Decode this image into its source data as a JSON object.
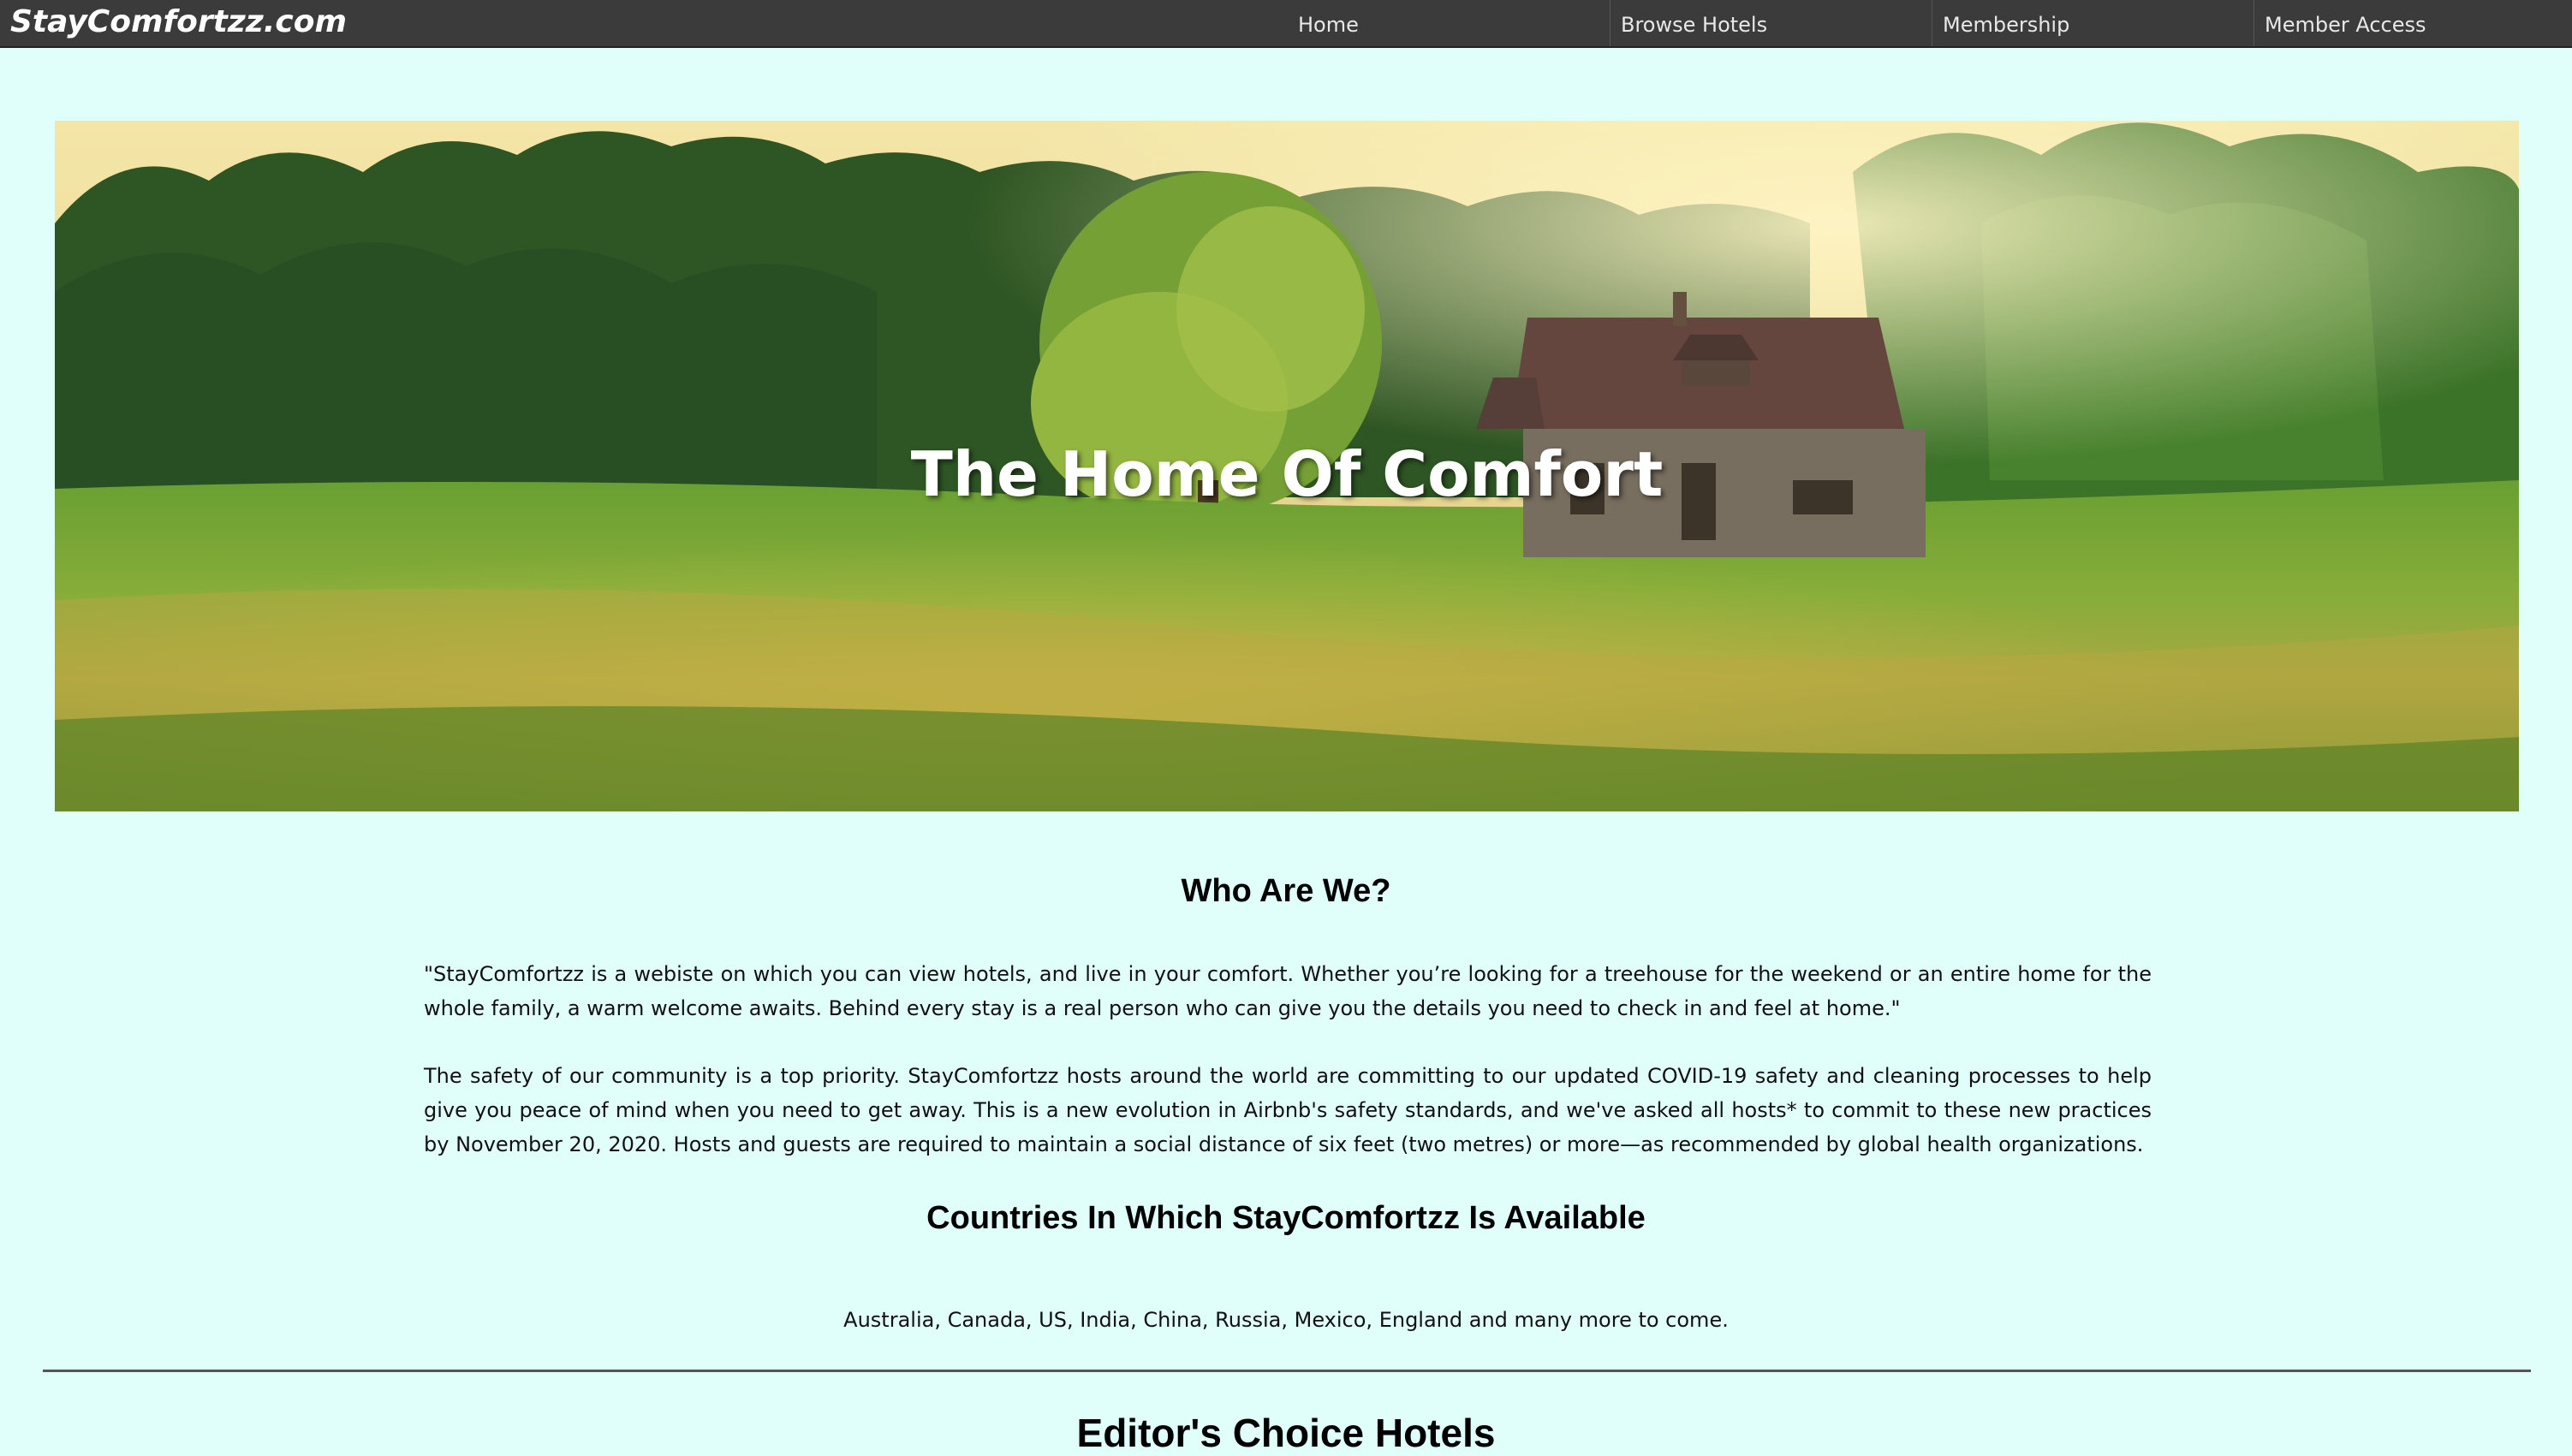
{
  "brand": "StayComfortzz.com",
  "nav": {
    "items": [
      {
        "label": "Home"
      },
      {
        "label": "Browse Hotels"
      },
      {
        "label": "Membership"
      },
      {
        "label": "Member Access"
      }
    ]
  },
  "hero": {
    "title": "The Home Of Comfort"
  },
  "about": {
    "heading": "Who Are We?",
    "paragraph1": "\"StayComfortzz is a webiste on which you can view hotels, and live in your comfort. Whether you’re looking for a treehouse for the weekend or an entire home for the whole family, a warm welcome awaits. Behind every stay is a real person who can give you the details you need to check in and feel at home.\"",
    "paragraph2": "The safety of our community is a top priority. StayComfortzz hosts around the world are committing to our updated COVID-19 safety and cleaning processes to help give you peace of mind when you need to get away. This is a new evolution in Airbnb's safety standards, and we've asked all hosts* to commit to these new practices by November 20, 2020. Hosts and guests are required to maintain a social distance of six feet (two metres) or more—as recommended by global health organizations."
  },
  "countries": {
    "heading": "Countries In Which StayComfortzz Is Available",
    "text": "Australia, Canada, US, India, China, Russia, Mexico, England and many more to come."
  },
  "editors": {
    "heading": "Editor's Choice Hotels"
  },
  "colors": {
    "page_background": "#e0fffb",
    "navbar_background": "#3b3b3b"
  }
}
